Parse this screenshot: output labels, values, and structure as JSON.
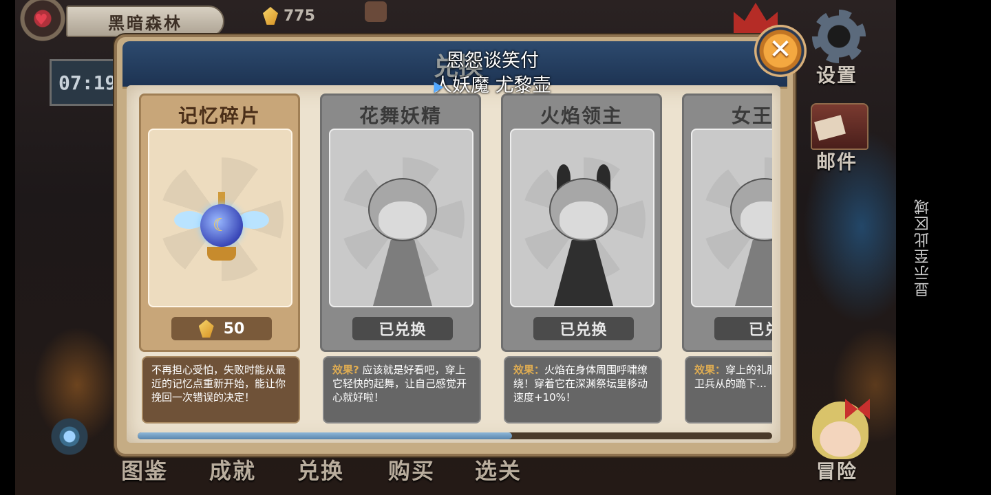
{
  "hud": {
    "location": "黑暗森林",
    "time": "07:19",
    "gems": "775"
  },
  "side": {
    "settings": "设置",
    "mail": "邮件",
    "adventure": "冒险",
    "hint": "显示至此区域"
  },
  "bottom_nav": [
    "图鉴",
    "成就",
    "兑换",
    "购买",
    "选关"
  ],
  "dialog": {
    "title": "兑换",
    "close_icon": "close-icon"
  },
  "overlay": {
    "line1": "恩怨谈笑付",
    "line2": "人妖魔 尤黎壶"
  },
  "cards": [
    {
      "title": "记忆碎片",
      "state": "price",
      "price": "50",
      "desc_label": "",
      "desc": "不再担心受怕，失败时能从最近的记忆点重新开始，能让你挽回一次错误的决定！"
    },
    {
      "title": "花舞妖精",
      "state": "已兑换",
      "desc_label": "效果?",
      "desc": " 应该就是好看吧，穿上它轻快的起舞，让自己感觉开心就好啦！"
    },
    {
      "title": "火焰领主",
      "state": "已兑换",
      "desc_label": "效果：",
      "desc": "火焰在身体周围呼啸缭绕！穿着它在深渊祭坛里移动速度+10%！"
    },
    {
      "title": "女王驾",
      "state": "已兑",
      "desc_label": "效果：",
      "desc": "穿上的礼服，威之处的卫兵从的跪下…"
    }
  ],
  "scroll_progress": 0.59,
  "colors": {
    "accent_gold": "#e0ad52",
    "header_blue": "#2d4a6e",
    "scroll_blue": "#5a86ad"
  }
}
